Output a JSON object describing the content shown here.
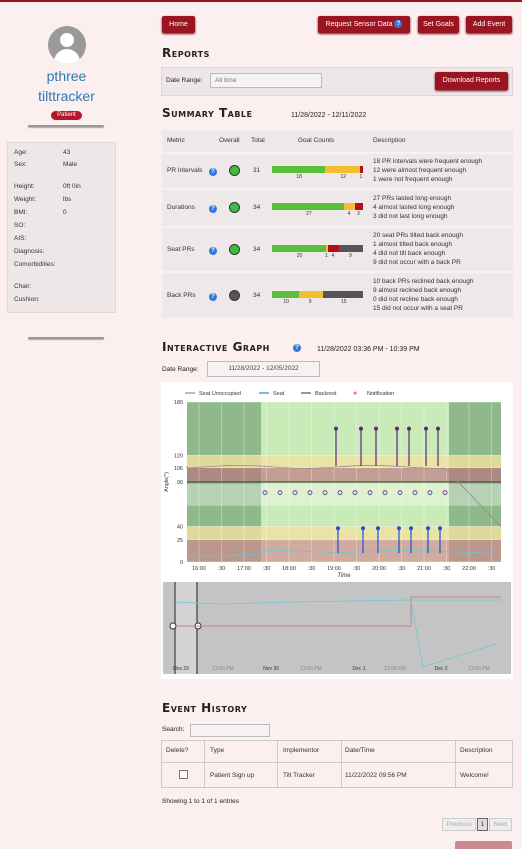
{
  "sidebar": {
    "first_name": "pthree",
    "last_name": "tilttracker",
    "role_badge": "Patient",
    "info": [
      {
        "label": "Age:",
        "value": "43"
      },
      {
        "label": "Sex:",
        "value": "Male"
      },
      {
        "label": "Height:",
        "value": "0ft 0in"
      },
      {
        "label": "Weight:",
        "value": "lbs"
      },
      {
        "label": "BMI:",
        "value": "0"
      },
      {
        "label": "SO:",
        "value": ""
      },
      {
        "label": "AIS:",
        "value": ""
      },
      {
        "label": "Diagnosis:",
        "value": ""
      },
      {
        "label": "Comorbidities:",
        "value": ""
      },
      {
        "label": "Chair:",
        "value": ""
      },
      {
        "label": "Cushion:",
        "value": ""
      }
    ]
  },
  "nav": {
    "home": "Home",
    "request_sensor": "Request Sensor Data",
    "set_goals": "Set Goals",
    "add_event": "Add Event"
  },
  "reports": {
    "title": "Reports",
    "date_range_label": "Date Range:",
    "date_range_placeholder": "All time",
    "download": "Download Reports"
  },
  "summary": {
    "title": "Summary Table",
    "date_range": "11/28/2022 - 12/11/2022",
    "headers": [
      "Metric",
      "Overall",
      "Total",
      "Goal Counts",
      "Description"
    ],
    "rows": [
      {
        "metric": "PR Intervals",
        "overall_color": "#3dbf3d",
        "total": "31",
        "bar": [
          {
            "color": "#5cbf3c",
            "value": 18,
            "label": "18"
          },
          {
            "color": "#f4bf2f",
            "value": 12,
            "label": "12"
          },
          {
            "color": "#b3101b",
            "value": 1,
            "label": "1"
          }
        ],
        "desc": [
          "18 PR intervals were frequent enough",
          "12 were almost frequent enough",
          "1 were not frequent enough"
        ]
      },
      {
        "metric": "Durations",
        "overall_color": "#3dbf3d",
        "total": "34",
        "bar": [
          {
            "color": "#5cbf3c",
            "value": 27,
            "label": "27"
          },
          {
            "color": "#f4bf2f",
            "value": 4,
            "label": "4"
          },
          {
            "color": "#b3101b",
            "value": 3,
            "label": "3"
          }
        ],
        "desc": [
          "27 PRs lasted long enough",
          "4 almost lasted long enough",
          "3 did not last long enough"
        ]
      },
      {
        "metric": "Seat PRs",
        "overall_color": "#3dbf3d",
        "total": "34",
        "bar": [
          {
            "color": "#5cbf3c",
            "value": 20,
            "label": "20"
          },
          {
            "color": "#f4bf2f",
            "value": 1,
            "label": "1"
          },
          {
            "color": "#b3101b",
            "value": 4,
            "label": "4"
          },
          {
            "color": "#555555",
            "value": 9,
            "label": "9"
          }
        ],
        "desc": [
          "20 seat PRs tilted back enough",
          "1 almost tilted back enough",
          "4 did not tilt back enough",
          "9 did not occur with a back PR"
        ]
      },
      {
        "metric": "Back PRs",
        "overall_color": "#555555",
        "total": "34",
        "bar": [
          {
            "color": "#5cbf3c",
            "value": 10,
            "label": "10"
          },
          {
            "color": "#f4bf2f",
            "value": 9,
            "label": "9"
          },
          {
            "color": "#555555",
            "value": 15,
            "label": "15"
          }
        ],
        "desc": [
          "10 back PRs reclined back enough",
          "9 almost reclined back enough",
          "0 did not recline back enough",
          "15 did not occur with a seat PR"
        ]
      }
    ]
  },
  "graph_section": {
    "title": "Interactive Graph",
    "date_range": "11/28/2022 03:36 PM - 10:39 PM",
    "date_range_label": "Date Range:",
    "date_range_value": "11/28/2022 - 12/05/2022"
  },
  "chart_data": {
    "type": "line",
    "legend": [
      "Seat Unoccupied",
      "Seat",
      "Backrest",
      "Notification"
    ],
    "legend_colors": [
      "#bbbbbb",
      "#6ac6d8",
      "#999999",
      "#e66fa8"
    ],
    "ylabel": "Angle(°)",
    "xlabel": "Time",
    "y_ticks": [
      "180",
      "120",
      "106",
      "90",
      "40",
      "25",
      "0"
    ],
    "x_ticks": [
      "16:00",
      ":30",
      "17:00",
      ":30",
      "18:00",
      ":30",
      "19:00",
      ":30",
      "20:00",
      ":30",
      "21:00",
      ":30",
      "22:00",
      ":30"
    ],
    "ylim": [
      0,
      180
    ],
    "nav_labels": [
      "Nov 29",
      "12:00 PM",
      "Nov 30",
      "12:00 PM",
      "Dec 1",
      "12:00 PM",
      "Dec 2",
      "12:00 PM"
    ]
  },
  "events": {
    "title": "Event History",
    "search_label": "Search:",
    "headers": [
      "Delete?",
      "Type",
      "Implementor",
      "Date/Time",
      "Description"
    ],
    "rows": [
      {
        "type": "Patient Sign up",
        "implementor": "Tilt Tracker",
        "datetime": "11/22/2022 09:56 PM",
        "description": "Welcome!"
      }
    ],
    "showing": "Showing 1 to 1 of 1 entries",
    "prev": "Previous",
    "page": "1",
    "next": "Next"
  }
}
